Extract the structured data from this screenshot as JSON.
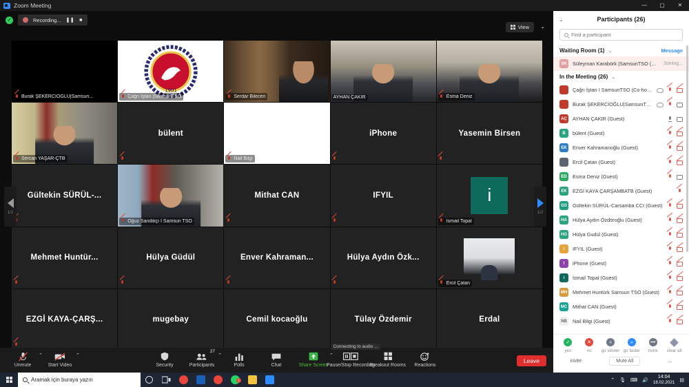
{
  "titlebar": {
    "app_icon": "zoom-icon",
    "title": "Zoom Meeting",
    "minimize": "—",
    "maximize": "▢",
    "close": "✕"
  },
  "recording": {
    "check": "✓",
    "label": "Recording...",
    "pause": "❚❚",
    "stop": "■"
  },
  "view": {
    "label": "View",
    "caret": "⌄"
  },
  "pager": {
    "left_page": "1/2",
    "right_page": "1/2"
  },
  "tiles": [
    {
      "name": "Burak ŞEKERCİOĞLU|Samsun...",
      "display": "label",
      "muted": true,
      "video": "black",
      "active": false
    },
    {
      "name": "Çağrı İştan |SamsunTSO",
      "display": "label",
      "muted": true,
      "video": "logo",
      "active": false
    },
    {
      "name": "Serdar Bilecen",
      "display": "label",
      "muted": true,
      "video": "bookshelf",
      "active": false
    },
    {
      "name": "AYHAN ÇAKIR",
      "display": "label",
      "muted": false,
      "video": "person-office",
      "active": true
    },
    {
      "name": "Esma Deniz",
      "display": "label",
      "muted": true,
      "video": "person-wall",
      "active": false
    },
    {
      "name": "Sercan YAŞAR-ÇTB",
      "display": "label",
      "muted": true,
      "video": "person-flag",
      "active": false
    },
    {
      "name": "bülent",
      "display": "center",
      "muted": true,
      "video": "none",
      "active": false
    },
    {
      "name": "Nail Bilgi",
      "display": "label",
      "muted": true,
      "video": "white",
      "active": false
    },
    {
      "name": "iPhone",
      "display": "center",
      "muted": true,
      "video": "none",
      "active": false
    },
    {
      "name": "Yasemin Birsen",
      "display": "center",
      "muted": true,
      "video": "none",
      "active": false
    },
    {
      "name": "Gültekin  SÜRÜL-...",
      "display": "center",
      "muted": true,
      "video": "none",
      "active": false
    },
    {
      "name": "Oğuz Sandıkçı I Samsun TSO",
      "display": "label",
      "muted": true,
      "video": "person-flag2",
      "active": false
    },
    {
      "name": "Mithat CAN",
      "display": "center",
      "muted": true,
      "video": "none",
      "active": false
    },
    {
      "name": "IFYIL",
      "display": "center",
      "muted": true,
      "video": "none",
      "active": false
    },
    {
      "name": "İsmail Topal",
      "display": "label",
      "muted": true,
      "video": "avatar",
      "avatar_letter": "i",
      "avatar_color": "#0e6b5c",
      "active": false
    },
    {
      "name": "Mehmet  Huntür...",
      "display": "center",
      "muted": true,
      "video": "none",
      "active": false
    },
    {
      "name": "Hülya Güdül",
      "display": "center",
      "muted": true,
      "video": "none",
      "active": false
    },
    {
      "name": "Enver  Kahraman...",
      "display": "center",
      "muted": true,
      "video": "none",
      "active": false
    },
    {
      "name": "Hülya Aydın Özk...",
      "display": "center",
      "muted": true,
      "video": "none",
      "active": false
    },
    {
      "name": "Ercil Çatan",
      "display": "label",
      "muted": true,
      "video": "person-screen",
      "active": false
    },
    {
      "name": "EZGİ  KAYA-ÇARŞ...",
      "display": "center",
      "muted": true,
      "video": "none",
      "active": false
    },
    {
      "name": "mugebay",
      "display": "center",
      "muted": false,
      "video": "none",
      "active": false
    },
    {
      "name": "Cemil kocaoğlu",
      "display": "center",
      "muted": false,
      "video": "none",
      "active": false
    },
    {
      "name": "Tülay Özdemir",
      "display": "center",
      "muted": false,
      "video": "none",
      "active": false,
      "status": "Connecting to audio ..."
    },
    {
      "name": "Erdal",
      "display": "center",
      "muted": false,
      "video": "none",
      "active": false
    }
  ],
  "toolbar": {
    "left": [
      {
        "label": "Unmute",
        "icon": "mic-off-icon",
        "caret": true,
        "green": false
      },
      {
        "label": "Start Video",
        "icon": "camera-off-icon",
        "caret": true,
        "green": false
      }
    ],
    "center": [
      {
        "label": "Security",
        "icon": "shield-icon",
        "caret": false,
        "green": false
      },
      {
        "label": "Participants",
        "icon": "people-icon",
        "caret": true,
        "green": false,
        "count": "27"
      },
      {
        "label": "Polls",
        "icon": "bar-chart-icon",
        "caret": false,
        "green": false
      },
      {
        "label": "Chat",
        "icon": "chat-bubble-icon",
        "caret": false,
        "green": false
      },
      {
        "label": "Share Screen",
        "icon": "share-screen-icon",
        "caret": true,
        "green": true
      },
      {
        "label": "Pause/Stop Recording",
        "icon": "pause-stop-icon",
        "caret": false,
        "green": false
      },
      {
        "label": "Breakout Rooms",
        "icon": "breakout-icon",
        "caret": false,
        "green": false
      },
      {
        "label": "Reactions",
        "icon": "reactions-icon",
        "caret": false,
        "green": false
      }
    ],
    "leave": "Leave"
  },
  "panel": {
    "chevron": "⌄",
    "title": "Participants (26)",
    "search_placeholder": "Find a participant",
    "search_value": "",
    "waiting_room": {
      "label": "Waiting Room (1)",
      "chevron": "⌄",
      "message_link": "Message",
      "rows": [
        {
          "initials": "SK",
          "color": "#e2a0a0",
          "name": "Süleyman Karabörk |SamsunTSO (Guest)",
          "status": "Joining..."
        }
      ]
    },
    "in_meeting": {
      "label": "In the Meeting (26)",
      "chevron": "⌄",
      "rows": [
        {
          "initials": "",
          "color": "#c0392b",
          "photo": true,
          "name": "Çağrı İştan I SamsunTSO (Co-host, me)",
          "host_badge": true,
          "mic": "off",
          "cam": "off"
        },
        {
          "initials": "",
          "color": "#c0392b",
          "photo": true,
          "name": "Burak ŞEKERCİOĞLU|SamsunTSO (Host)",
          "host_badge": true,
          "mic": "off",
          "cam": "on"
        },
        {
          "initials": "AÇ",
          "color": "#c0392b",
          "name": "AYHAN ÇAKIR (Guest)",
          "mic": "on",
          "cam": "on"
        },
        {
          "initials": "B",
          "color": "#2aa37f",
          "name": "bülent (Guest)",
          "mic": "off",
          "cam": "off"
        },
        {
          "initials": "EK",
          "color": "#2e7ec4",
          "name": "Enver Kahramanoğlu (Guest)",
          "mic": "off",
          "cam": "off"
        },
        {
          "initials": "",
          "color": "#5c6470",
          "photo": true,
          "name": "Ercil Çatan (Guest)",
          "mic": "off",
          "cam": "off"
        },
        {
          "initials": "ED",
          "color": "#2fa863",
          "name": "Esma Deniz (Guest)",
          "mic": "off",
          "cam": "on"
        },
        {
          "initials": "EK",
          "color": "#2aa37f",
          "name": "EZGİ KAYA ÇARŞAMBATB (Guest)",
          "mic": "off",
          "cam": "none"
        },
        {
          "initials": "GS",
          "color": "#1f9e82",
          "name": "Gültekin SÜRÜL-Carsamba CCI (Guest)",
          "mic": "off",
          "cam": "off"
        },
        {
          "initials": "HA",
          "color": "#2aa37f",
          "name": "Hülya Aydın Özdöroğlu (Guest)",
          "mic": "off",
          "cam": "off"
        },
        {
          "initials": "HG",
          "color": "#2aa37f",
          "name": "Hülya Gudul (Guest)",
          "mic": "off",
          "cam": "off"
        },
        {
          "initials": "I",
          "color": "#e8a33d",
          "name": "IFYIL (Guest)",
          "mic": "off",
          "cam": "off"
        },
        {
          "initials": "I",
          "color": "#8e44ad",
          "name": "iPhone (Guest)",
          "mic": "off",
          "cam": "off"
        },
        {
          "initials": "i",
          "color": "#0e6b5c",
          "name": "İsmail Topal (Guest)",
          "mic": "off",
          "cam": "off"
        },
        {
          "initials": "MH",
          "color": "#d79a3c",
          "name": "Mehmet Huntürk Samsun TSO (Guest)",
          "mic": "off",
          "cam": "off"
        },
        {
          "initials": "MC",
          "color": "#17a398",
          "name": "Mithat CAN (Guest)",
          "mic": "off",
          "cam": "off"
        },
        {
          "initials": "NB",
          "color": "#f0f0f0",
          "name": "Nail Bilgi (Guest)",
          "mic": "off",
          "cam": "off"
        }
      ]
    },
    "reactions": [
      {
        "label": "yes",
        "glyph": "✓",
        "color": "#24b35f",
        "shape": "circle"
      },
      {
        "label": "no",
        "glyph": "✕",
        "color": "#e14b3c",
        "shape": "circle"
      },
      {
        "label": "go slower",
        "glyph": "«",
        "color": "#6f7684",
        "shape": "circle"
      },
      {
        "label": "go faster",
        "glyph": "»",
        "color": "#2d8cff",
        "shape": "circle"
      },
      {
        "label": "more",
        "glyph": "•••",
        "color": "#6f7684",
        "shape": "circle"
      },
      {
        "label": "clear all",
        "glyph": "",
        "color": "#8c93a8",
        "shape": "diamond"
      }
    ],
    "footer_buttons": [
      {
        "label": "invite",
        "style": "plain"
      },
      {
        "label": "Mute All",
        "style": "outlined"
      },
      {
        "label": "...",
        "style": "plain"
      }
    ]
  },
  "taskbar": {
    "start_icon": "windows-icon",
    "search_placeholder": "Aramak için buraya yazın",
    "icons": [
      {
        "name": "cortana-icon",
        "color": "#dfdfdf",
        "shape": "circle"
      },
      {
        "name": "task-view-icon",
        "color": "#dfdfdf",
        "shape": "taskview"
      },
      {
        "name": "chrome-icon",
        "color": "#e8453c",
        "shape": "circle"
      },
      {
        "name": "outlook-icon",
        "color": "#1a5fb4",
        "shape": "square"
      },
      {
        "name": "chrome-icon-2",
        "color": "#e8453c",
        "shape": "circle"
      },
      {
        "name": "whatsapp-icon",
        "color": "#25d366",
        "shape": "circle",
        "badge": "1"
      },
      {
        "name": "file-explorer-icon",
        "color": "#f5c242",
        "shape": "square"
      },
      {
        "name": "zoom-taskbar-icon",
        "color": "#2d8cff",
        "shape": "square"
      }
    ],
    "tray": {
      "chevron": "⌃",
      "mic": "mic-icon",
      "network": "network-icon",
      "volume": "volume-icon",
      "time": "14:04",
      "date": "18.02.2021",
      "notification": "notification-icon"
    }
  }
}
